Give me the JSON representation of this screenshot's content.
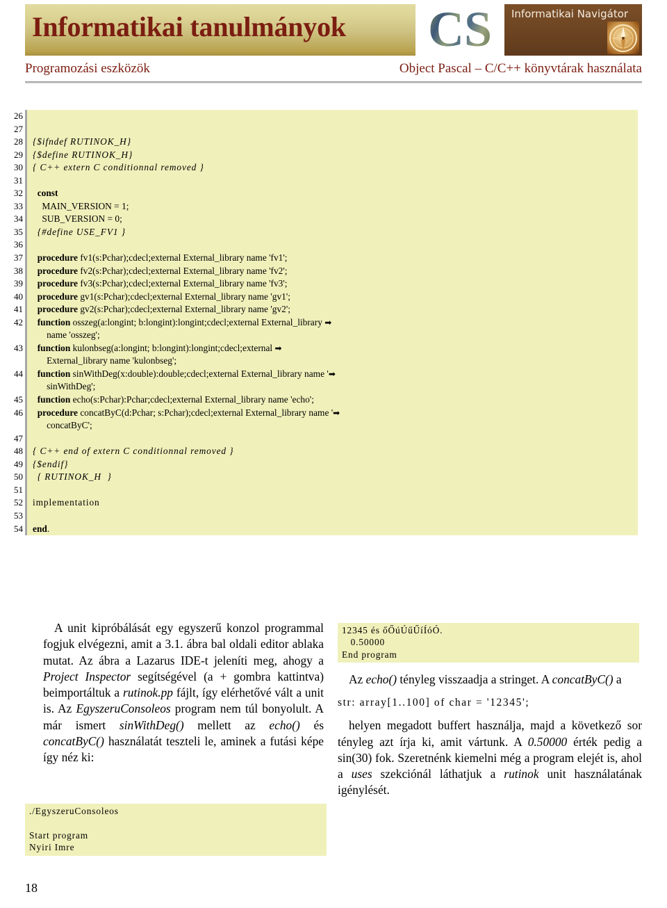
{
  "header": {
    "banner_title": "Informatikai tanulmányok",
    "logo_text": "CS",
    "navigator_label": "Informatikai Navigátor",
    "compass_icon": "compass-icon",
    "subtitle_left": "Programozási eszközök",
    "subtitle_right": "Object Pascal – C/C++ könyvtárak használata"
  },
  "listing": {
    "line_numbers": [
      "26",
      "27",
      "28",
      "29",
      "30",
      "31",
      "32",
      "33",
      "34",
      "35",
      "36",
      "37",
      "38",
      "39",
      "40",
      "41",
      "42",
      "43",
      "44",
      "45",
      "46",
      "47",
      "48",
      "49",
      "50",
      "51",
      "52",
      "53",
      "54"
    ],
    "lines": [
      "",
      "",
      "{$ifndef RUTINOK_H}",
      "{$define RUTINOK_H}",
      "{ C++ extern C conditionnal removed }",
      "",
      "  const",
      "    MAIN_VERSION = 1;",
      "    SUB_VERSION = 0;",
      "  {#define USE_FV1 }",
      "",
      "  procedure fv1(s:Pchar);cdecl;external External_library name 'fv1';",
      "  procedure fv2(s:Pchar);cdecl;external External_library name 'fv2';",
      "  procedure fv3(s:Pchar);cdecl;external External_library name 'fv3';",
      "  procedure gv1(s:Pchar);cdecl;external External_library name 'gv1';",
      "  procedure gv2(s:Pchar);cdecl;external External_library name 'gv2';",
      "  function osszeg(a:longint; b:longint):longint;cdecl;external External_library name 'osszeg';",
      "  function kulonbseg(a:longint; b:longint):longint;cdecl;external External_library name 'kulonbseg';",
      "  function sinWithDeg(x:double):double;cdecl;external External_library name 'sinWithDeg';",
      "  function echo(s:Pchar):Pchar;cdecl;external External_library name 'echo';",
      "  procedure concatByC(d:Pchar; s:Pchar);cdecl;external External_library name 'concatByC';",
      "",
      "{ C++ end of extern C conditionnal removed }",
      "{$endif}",
      "  { RUTINOK_H  }",
      "",
      "implementation",
      "",
      "end."
    ],
    "wrap_arrow": "➡",
    "background_color": "#f0f0bb"
  },
  "left_column": {
    "paragraph_1": {
      "part_1": "A unit kipróbálását egy egyszerű konzol programmal fogjuk elvégezni, amit a 3.1. ábra bal oldali editor ablaka mutat. Az ábra a Lazarus IDE-t jeleníti meg, ahogy a ",
      "em_1": "Project Inspector",
      "part_2": " segítségével (a + gombra kattintva) beimportáltuk a ",
      "em_2": "rutinok.pp",
      "part_3": " fájlt, így elérhetővé vált a unit is. Az ",
      "em_3": "EgyszeruConsoleos",
      "part_4": " program nem túl bonyolult. A már ismert ",
      "em_4": "sinWithDeg()",
      "part_5": " mellett az ",
      "em_5": "echo()",
      "part_6": " és ",
      "em_6": "concatByC()",
      "part_7": " használatát teszteli le, aminek a futási képe így néz ki:"
    },
    "output_block": "./EgyszeruConsoleos\n\nStart program\nNyiri Imre"
  },
  "right_column": {
    "output_block": "12345 és őŐúÚűŰíÍóÓ.\n   0.50000\nEnd program",
    "paragraph_1": {
      "part_1": "Az ",
      "em_1": "echo()",
      "part_2": " tényleg visszaadja a stringet. A ",
      "em_2": "concatByC()",
      "part_3": " a"
    },
    "code_line": "str: array[1..100] of char = '12345';",
    "paragraph_2": {
      "part_1": "helyen megadott buffert használja, majd a következő sor tényleg azt írja ki, amit vártunk. A ",
      "em_1": "0.50000",
      "part_2": " érték pedig a sin(30) fok. Szeretnénk kiemelni még a program elejét is, ahol a ",
      "em_2": "uses",
      "part_3": " szekciónál láthatjuk a ",
      "em_3": "rutinok",
      "part_4": " unit használatának igénylését."
    }
  },
  "footer": {
    "page_number": "18"
  },
  "colors": {
    "banner_gold_top": "#e2dba0",
    "banner_gold_bottom": "#a98f3c",
    "banner_brown": "#6d4422",
    "heading_red": "#7b1d11",
    "code_bg": "#f0f0bb",
    "rule_gray": "#a8a8a8"
  }
}
